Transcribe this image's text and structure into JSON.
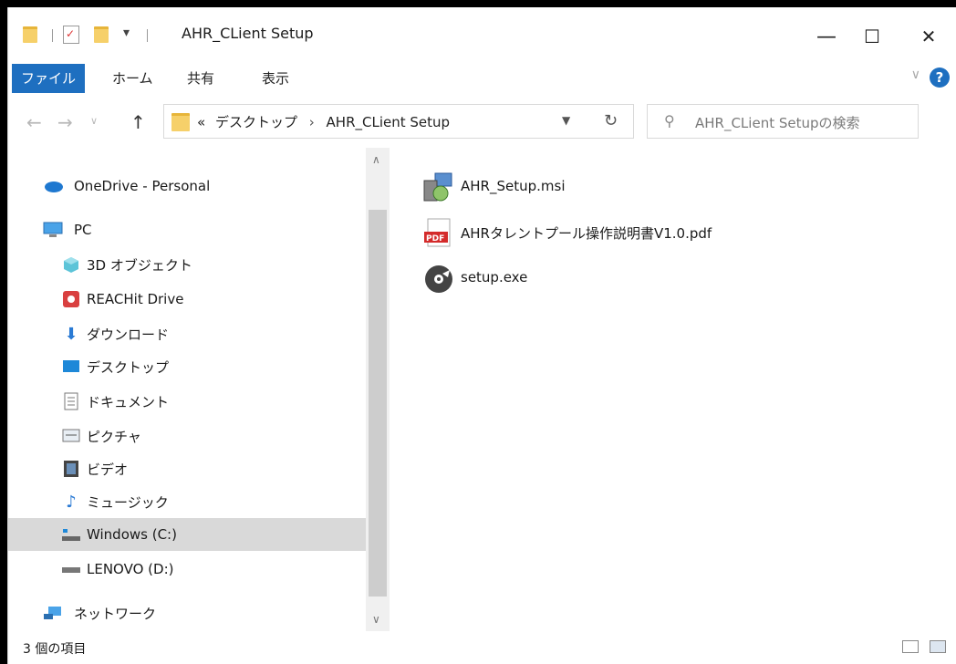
{
  "window": {
    "title": "AHR_CLient Setup",
    "controls": {
      "minimize": "—",
      "maximize": "☐",
      "close": "✕"
    }
  },
  "ribbon": {
    "tabs": [
      {
        "label": "ファイル",
        "active": true
      },
      {
        "label": "ホーム"
      },
      {
        "label": "共有"
      },
      {
        "label": "表示"
      }
    ],
    "help": "?"
  },
  "address": {
    "crumbs_prefix": "«",
    "crumb1": "デスクトップ",
    "crumb_sep": "›",
    "crumb2": "AHR_CLient Setup"
  },
  "search": {
    "placeholder": "AHR_CLient Setupの検索"
  },
  "sidebar": {
    "items": [
      {
        "label": "OneDrive - Personal",
        "icon": "cloud-icon"
      },
      {
        "label": "PC",
        "icon": "pc-icon"
      },
      {
        "label": "3D オブジェクト",
        "icon": "cube-icon"
      },
      {
        "label": "REACHit Drive",
        "icon": "reachit-icon"
      },
      {
        "label": "ダウンロード",
        "icon": "download-icon"
      },
      {
        "label": "デスクトップ",
        "icon": "desktop-icon"
      },
      {
        "label": "ドキュメント",
        "icon": "document-icon"
      },
      {
        "label": "ピクチャ",
        "icon": "picture-icon"
      },
      {
        "label": "ビデオ",
        "icon": "video-icon"
      },
      {
        "label": "ミュージック",
        "icon": "music-icon"
      },
      {
        "label": "Windows (C:)",
        "icon": "drive-c-icon",
        "selected": true
      },
      {
        "label": "LENOVO (D:)",
        "icon": "drive-d-icon"
      },
      {
        "label": "ネットワーク",
        "icon": "network-icon"
      }
    ]
  },
  "files": [
    {
      "name": "AHR_Setup.msi",
      "icon": "msi-icon"
    },
    {
      "name": "AHRタレントプール操作説明書V1.0.pdf",
      "icon": "pdf-icon"
    },
    {
      "name": "setup.exe",
      "icon": "exe-icon"
    }
  ],
  "status": {
    "count": "3 個の項目"
  },
  "colors": {
    "accent": "#1e6fc0",
    "folder": "#f6d06a",
    "selected": "#d9d9d9"
  }
}
